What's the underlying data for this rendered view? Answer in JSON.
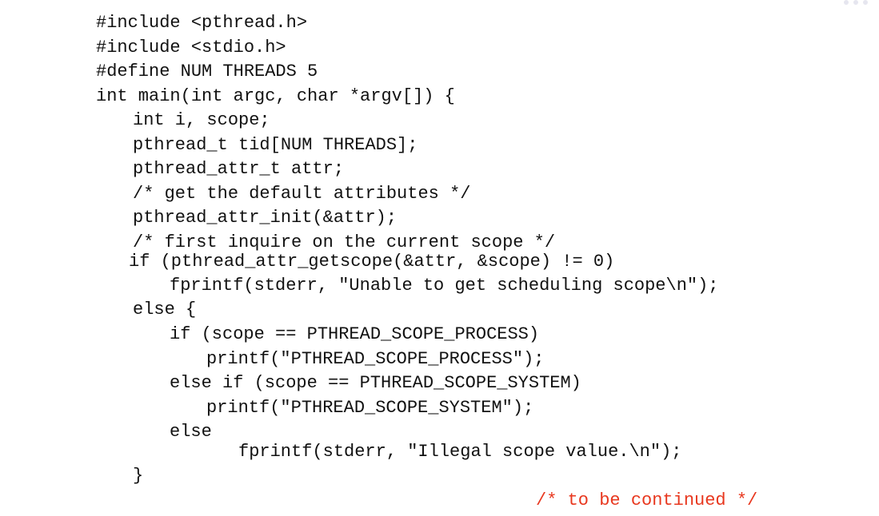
{
  "code": {
    "lines": [
      "#include <pthread.h>",
      "#include <stdio.h>",
      "#define NUM THREADS 5",
      "int main(int argc, char *argv[]) {",
      "int i, scope;",
      "pthread_t tid[NUM THREADS];",
      "pthread_attr_t attr;",
      "/* get the default attributes */",
      "pthread_attr_init(&attr);",
      "/* first inquire on the current scope */",
      "if (pthread_attr_getscope(&attr, &scope) != 0)",
      "fprintf(stderr, \"Unable to get scheduling scope\\n\");",
      "else {",
      "if (scope == PTHREAD_SCOPE_PROCESS)",
      "printf(\"PTHREAD_SCOPE_PROCESS\");",
      "else if (scope == PTHREAD_SCOPE_SYSTEM)",
      "printf(\"PTHREAD_SCOPE_SYSTEM\");",
      "else",
      "fprintf(stderr, \"Illegal scope value.\\n\");",
      "}",
      "/* to be continued */"
    ]
  },
  "colors": {
    "text": "#111111",
    "comment_red": "#e8371e",
    "background": "#ffffff"
  }
}
